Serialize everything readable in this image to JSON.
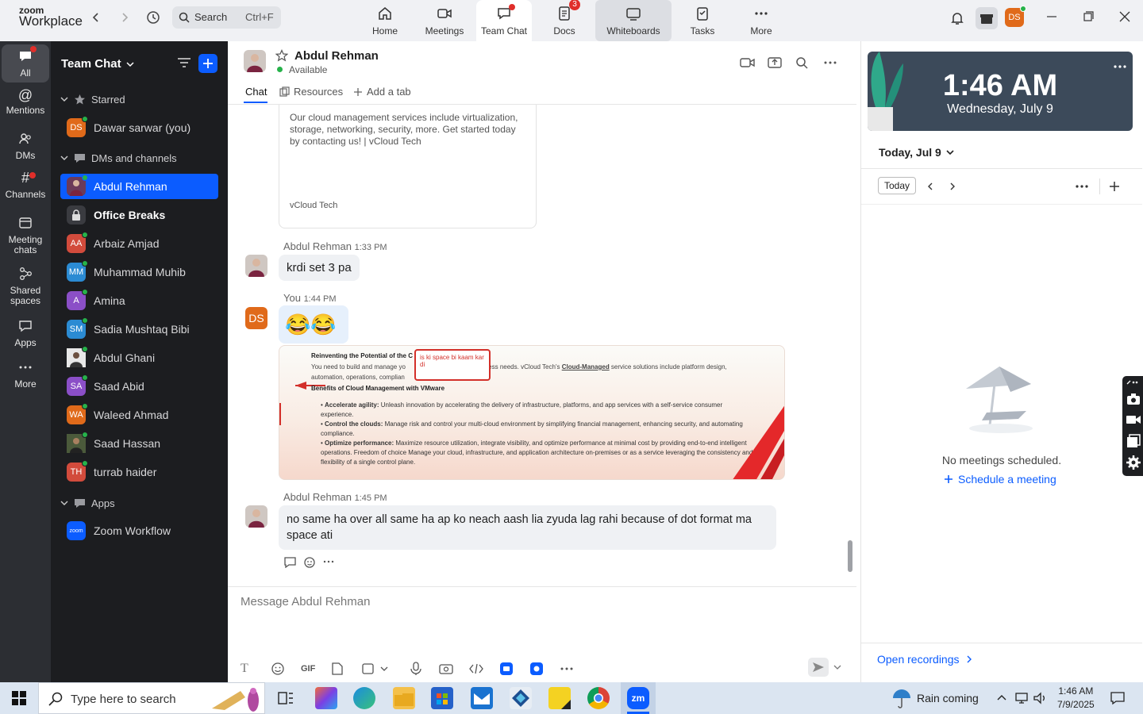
{
  "app": {
    "brand_top": "zoom",
    "brand_bottom": "Workplace",
    "search_placeholder": "Search",
    "search_shortcut": "Ctrl+F"
  },
  "nav": {
    "home": "Home",
    "meetings": "Meetings",
    "team_chat": "Team Chat",
    "docs": "Docs",
    "docs_badge": "3",
    "whiteboards": "Whiteboards",
    "tasks": "Tasks",
    "more": "More"
  },
  "user": {
    "initials": "DS"
  },
  "rail": {
    "all": "All",
    "mentions": "Mentions",
    "dms": "DMs",
    "channels": "Channels",
    "meeting_chats": "Meeting chats",
    "shared_spaces": "Shared spaces",
    "apps": "Apps",
    "more": "More"
  },
  "sidebar": {
    "title": "Team Chat",
    "starred": "Starred",
    "self": {
      "initials": "DS",
      "name": "Dawar sarwar (you)"
    },
    "dms_header": "DMs and channels",
    "items": [
      {
        "initials": "",
        "name": "Abdul Rehman",
        "color": "#6b3a5a"
      },
      {
        "initials": "",
        "name": "Office Breaks",
        "color": "#3a3b40"
      },
      {
        "initials": "AA",
        "name": "Arbaiz Amjad",
        "color": "#d24b3c"
      },
      {
        "initials": "MM",
        "name": "Muhammad Muhib",
        "color": "#2b8bd3"
      },
      {
        "initials": "A",
        "name": "Amina",
        "color": "#8b4fc7"
      },
      {
        "initials": "SM",
        "name": "Sadia Mushtaq Bibi",
        "color": "#2b8bd3"
      },
      {
        "initials": "",
        "name": "Abdul Ghani",
        "color": "#555"
      },
      {
        "initials": "SA",
        "name": "Saad Abid",
        "color": "#8b4fc7"
      },
      {
        "initials": "WA",
        "name": "Waleed Ahmad",
        "color": "#e06a1a"
      },
      {
        "initials": "",
        "name": "Saad Hassan",
        "color": "#3d6b3d"
      },
      {
        "initials": "TH",
        "name": "turrab haider",
        "color": "#d24b3c"
      }
    ],
    "apps_header": "Apps",
    "app_item": "Zoom Workflow",
    "app_logo": "zoom"
  },
  "chat": {
    "contact": "Abdul Rehman",
    "status": "Available",
    "tabs": {
      "chat": "Chat",
      "resources": "Resources",
      "add": "Add a tab"
    },
    "link_desc": "Our cloud management services include virtualization, storage, networking, security, more. Get started today by contacting us! | vCloud Tech",
    "link_source": "vCloud Tech",
    "msg1": {
      "sender": "Abdul Rehman",
      "time": "1:33 PM",
      "text": "krdi set 3 pa"
    },
    "msg2": {
      "sender": "You",
      "time": "1:44 PM",
      "initials": "DS",
      "emoji": "😂😂"
    },
    "shot": {
      "title": "Reinventing the Potential of the C",
      "line1a": "You need to build and manage yo",
      "line1b": "iness needs. vCloud Tech's ",
      "line1c": "Cloud-Managed",
      "line1d": " service solutions include platform design,",
      "line2": "automation, operations, complian",
      "note": "is ki space bi kaam kar di",
      "heading": "Benefits of Cloud Management with VMware",
      "b1h": "Accelerate agility:",
      "b1": " Unleash innovation by accelerating the delivery of infrastructure, platforms, and app services with a self-service consumer experience.",
      "b2h": "Control the clouds:",
      "b2": " Manage risk and control your multi-cloud environment by simplifying financial management, enhancing security, and automating compliance.",
      "b3h": "Optimize performance:",
      "b3": " Maximize resource utilization, integrate visibility, and optimize performance at minimal cost by providing end-to-end intelligent operations. Freedom of choice Manage your cloud, infrastructure, and application architecture on-premises or as a service leveraging the consistency and flexibility of a single control plane."
    },
    "msg3": {
      "sender": "Abdul Rehman",
      "time": "1:45 PM",
      "text": "no same ha  over all same ha ap ko neach aash lia zyuda lag rahi because of dot format ma space ati"
    },
    "composer_placeholder": "Message Abdul Rehman",
    "gif": "GIF"
  },
  "calendar": {
    "time": "1:46 AM",
    "date": "Wednesday, July 9",
    "today_header": "Today, Jul 9",
    "today_btn": "Today",
    "empty": "No meetings scheduled.",
    "schedule": "Schedule a meeting",
    "recordings": "Open recordings"
  },
  "taskbar": {
    "search": "Type here to search",
    "weather": "Rain coming",
    "time": "1:46 AM",
    "date": "7/9/2025"
  },
  "colors": {
    "accent": "#0b5cff",
    "sidebar_bg": "#1c1d20",
    "rail_bg": "#2c2e33",
    "online": "#26b24a",
    "badge": "#e02e2a"
  }
}
